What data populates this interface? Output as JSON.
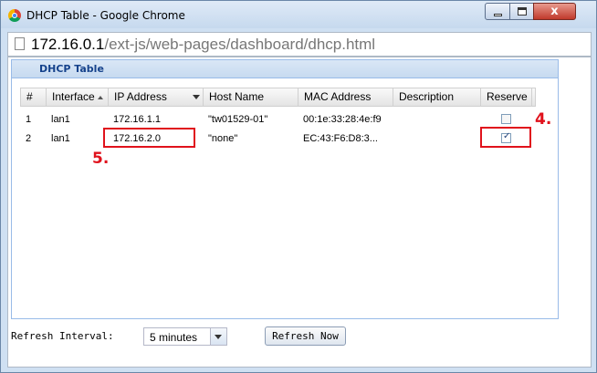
{
  "window": {
    "title": "DHCP Table - Google Chrome",
    "close_glyph": "x"
  },
  "address_bar": {
    "url_host": "172.16.0.1",
    "url_path": "/ext-js/web-pages/dashboard/dhcp.html"
  },
  "panel": {
    "title": "DHCP Table"
  },
  "table": {
    "columns": [
      "#",
      "Interface",
      "IP Address",
      "Host Name",
      "MAC Address",
      "Description",
      "Reserve"
    ],
    "sorted_column": "Interface",
    "rows": [
      {
        "num": "1",
        "interface": "lan1",
        "ip": "172.16.1.1",
        "host": "\"tw01529-01\"",
        "mac": "00:1e:33:28:4e:f9",
        "description": "",
        "reserve": false
      },
      {
        "num": "2",
        "interface": "lan1",
        "ip": "172.16.2.0",
        "host": "\"none\"",
        "mac": "EC:43:F6:D8:3...",
        "description": "",
        "reserve": true
      }
    ]
  },
  "annotations": {
    "reserve_label": "4.",
    "ip_label": "5.",
    "color": "#e0121c"
  },
  "refresh": {
    "label": "Refresh Interval:",
    "interval_value": "5 minutes",
    "button_label": "Refresh Now"
  },
  "icons": [
    "chrome-icon",
    "page-icon",
    "sort-asc-icon",
    "column-menu-icon",
    "dropdown-arrow-icon"
  ]
}
